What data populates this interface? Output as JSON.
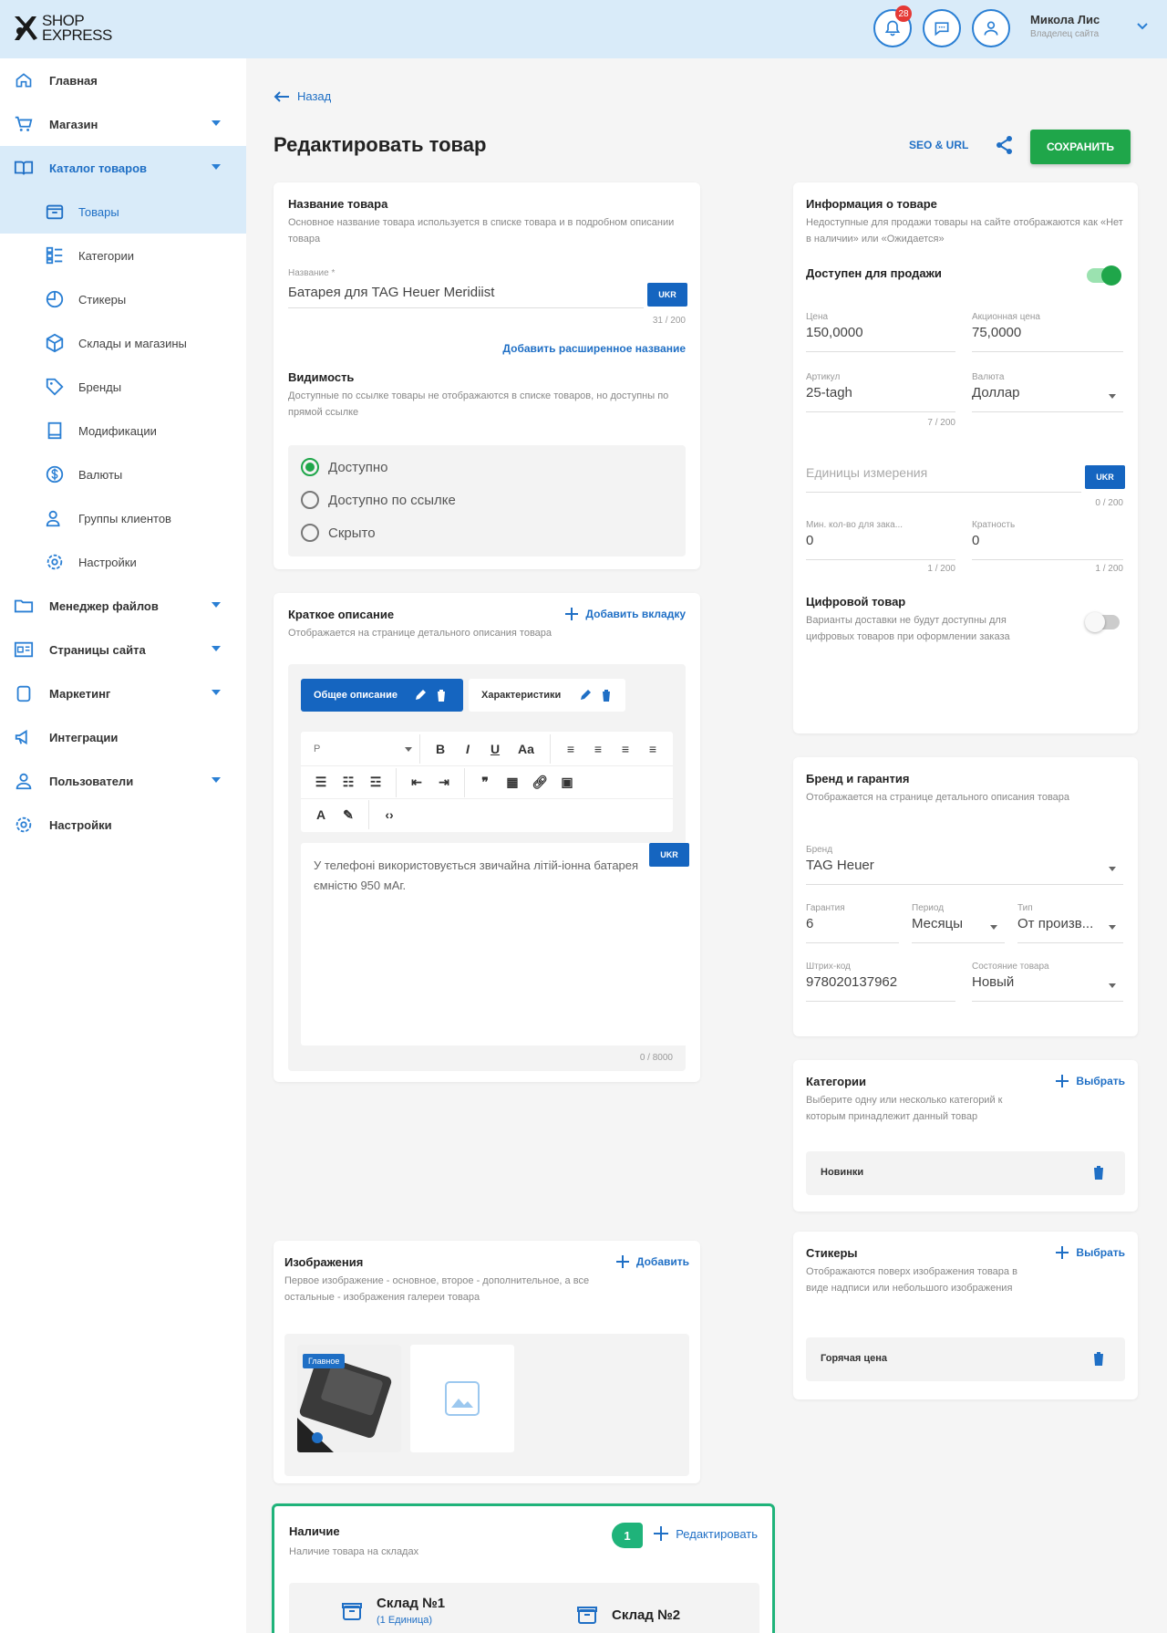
{
  "brand": {
    "line1": "SHOP",
    "line2": "EXPRESS"
  },
  "header": {
    "notification_count": "28",
    "user_name": "Микола Лис",
    "user_role": "Владелец сайта"
  },
  "sidebar": {
    "items": [
      {
        "label": "Главная",
        "icon": "home-icon"
      },
      {
        "label": "Магазин",
        "icon": "cart-icon",
        "expandable": true
      },
      {
        "label": "Каталог товаров",
        "icon": "book-icon",
        "expandable": true,
        "active": true
      }
    ],
    "subitems": [
      {
        "label": "Товары",
        "icon": "box-icon",
        "active": true
      },
      {
        "label": "Категории",
        "icon": "category-icon"
      },
      {
        "label": "Стикеры",
        "icon": "sticker-icon"
      },
      {
        "label": "Склады и магазины",
        "icon": "warehouse-icon"
      },
      {
        "label": "Бренды",
        "icon": "tag-icon"
      },
      {
        "label": "Модификации",
        "icon": "modification-icon"
      },
      {
        "label": "Валюты",
        "icon": "currency-icon"
      },
      {
        "label": "Группы клиентов",
        "icon": "group-icon"
      },
      {
        "label": "Настройки",
        "icon": "settings-icon"
      }
    ],
    "bottom_items": [
      {
        "label": "Менеджер файлов",
        "icon": "folder-icon",
        "expandable": true
      },
      {
        "label": "Страницы сайта",
        "icon": "pages-icon",
        "expandable": true
      },
      {
        "label": "Маркетинг",
        "icon": "marketing-icon",
        "expandable": true
      },
      {
        "label": "Интеграции",
        "icon": "integration-icon"
      },
      {
        "label": "Пользователи",
        "icon": "users-icon",
        "expandable": true
      },
      {
        "label": "Настройки",
        "icon": "gear-icon"
      }
    ]
  },
  "page": {
    "back_label": "Назад",
    "title": "Редактировать товар",
    "seo_label": "SEO & URL",
    "save_label": "СОХРАНИТЬ"
  },
  "name_card": {
    "title": "Название товара",
    "desc": "Основное название товара используется в списке товара и в подробном описании товара",
    "field_label": "Название *",
    "field_value": "Батарея для TAG Heuer Meridiist",
    "lang": "UKR",
    "counter": "31 / 200",
    "extended_link": "Добавить расширенное название",
    "visibility_title": "Видимость",
    "visibility_desc": "Доступные по ссылке товары не отображаются в списке товаров, но доступны по прямой ссылке",
    "options": [
      "Доступно",
      "Доступно по ссылке",
      "Скрыто"
    ]
  },
  "desc_card": {
    "title": "Краткое описание",
    "desc": "Отображается на странице детального описания товара",
    "add_tab": "Добавить вкладку",
    "tabs": [
      "Общее описание",
      "Характеристики"
    ],
    "format_value": "P",
    "text": "У телефоні використовується звичайна літій-іонна батарея ємністю 950 мАг.",
    "lang": "UKR",
    "counter": "0 / 8000"
  },
  "images_card": {
    "title": "Изображения",
    "desc": "Первое изображение - основное, второе - дополнительное, а все остальные - изображения галереи товара",
    "add_label": "Добавить",
    "main_badge": "Главное"
  },
  "stock_card": {
    "title": "Наличие",
    "desc": "Наличие товара на складах",
    "edit_label": "Редактировать",
    "step": "1",
    "warehouses": [
      {
        "name": "Склад №1",
        "sub": "(1 Единица)"
      },
      {
        "name": "Склад №2",
        "sub": ""
      }
    ]
  },
  "info_card": {
    "title": "Информация о товаре",
    "desc": "Недоступные для продажи товары на сайте отображаются как «Нет в наличии» или «Ожидается»",
    "available_label": "Доступен для продажи",
    "available": true,
    "price_label": "Цена",
    "price": "150,0000",
    "promo_label": "Акционная цена",
    "promo": "75,0000",
    "sku_label": "Артикул",
    "sku": "25-tagh",
    "sku_counter": "7 / 200",
    "currency_label": "Валюта",
    "currency": "Доллар",
    "unit_placeholder": "Единицы измерения",
    "unit_lang": "UKR",
    "unit_counter": "0 / 200",
    "min_label": "Мин. кол-во для зака...",
    "min": "0",
    "min_counter": "1 / 200",
    "mult_label": "Кратность",
    "mult": "0",
    "mult_counter": "1 / 200",
    "digital_title": "Цифровой товар",
    "digital_desc": "Варианты доставки не будут доступны для цифровых товаров при оформлении заказа",
    "digital": false
  },
  "brand_card": {
    "title": "Бренд и гарантия",
    "desc": "Отображается на странице детального описания товара",
    "brand_label": "Бренд",
    "brand": "TAG Heuer",
    "warranty_label": "Гарантия",
    "warranty": "6",
    "period_label": "Период",
    "period": "Месяцы",
    "type_label": "Тип",
    "type": "От произв...",
    "barcode_label": "Штрих-код",
    "barcode": "978020137962",
    "condition_label": "Состояние товара",
    "condition": "Новый"
  },
  "categories_card": {
    "title": "Категории",
    "desc": "Выберите одну или несколько категорий к которым принадлежит данный товар",
    "select_label": "Выбрать",
    "items": [
      "Новинки"
    ]
  },
  "stickers_card": {
    "title": "Стикеры",
    "desc": "Отображаются поверх изображения товара в виде надписи или небольшого изображения",
    "select_label": "Выбрать",
    "items": [
      "Горячая цена"
    ]
  },
  "colors": {
    "accent": "#1f6fc5",
    "save": "#1fa64a",
    "header_bg": "#d9ebf9",
    "highlight": "#1fb37a"
  }
}
